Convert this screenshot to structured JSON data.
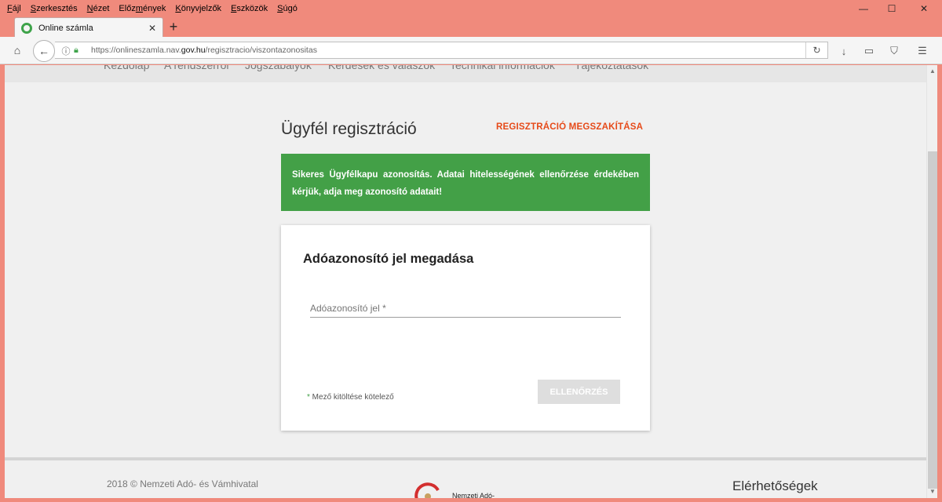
{
  "menu": [
    "Fájl",
    "Szerkesztés",
    "Nézet",
    "Előzmények",
    "Könyvjelzők",
    "Eszközök",
    "Súgó"
  ],
  "menu_access": [
    "F",
    "S",
    "N",
    "m",
    "K",
    "E",
    "S"
  ],
  "window_controls": {
    "minimize": "—",
    "maximize": "☐",
    "close": "✕"
  },
  "tab": {
    "title": "Online számla",
    "close": "✕",
    "new_tab": "+"
  },
  "nav": {
    "home_icon": "⌂",
    "back_icon": "←",
    "url_prefix": "https://onlineszamla.nav.",
    "url_domain": "gov.hu",
    "url_path": "/regisztracio/viszontazonositas",
    "reload_icon": "↻",
    "download_icon": "↓",
    "reader_icon": "▭",
    "shield_icon": "⛉",
    "menu_icon": "☰"
  },
  "top_nav": [
    "Kezdőlap",
    "A rendszerről",
    "Jogszabályok",
    "Kérdések és válaszok",
    "Technikai információk",
    "Tájékoztatások"
  ],
  "page": {
    "title": "Ügyfél regisztráció",
    "cancel": "REGISZTRÁCIÓ MEGSZAKÍTÁSA",
    "alert": "Sikeres Ügyfélkapu azonosítás. Adatai hitelességének ellenőrzése érdekében kérjük, adja meg azonosító adatait!"
  },
  "card": {
    "title": "Adóazonosító jel megadása",
    "field_placeholder": "Adóazonosító jel *",
    "field_value": "",
    "required_star": "*",
    "required_note": " Mező kitöltése kötelező",
    "check_button": "ELLENŐRZÉS"
  },
  "footer": {
    "copyright": "2018 © Nemzeti Adó- és Vámhivatal",
    "logo_text": "Nemzeti Adó-",
    "contacts": "Elérhetőségek"
  },
  "colors": {
    "window_frame": "#f08a7c",
    "success": "#43a047",
    "accent": "#e64a19",
    "disabled_button": "#dedede"
  }
}
